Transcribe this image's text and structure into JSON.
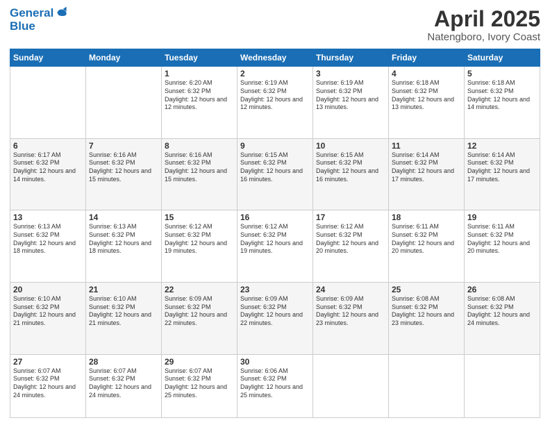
{
  "header": {
    "logo_line1": "General",
    "logo_line2": "Blue",
    "title": "April 2025",
    "subtitle": "Natengboro, Ivory Coast"
  },
  "weekdays": [
    "Sunday",
    "Monday",
    "Tuesday",
    "Wednesday",
    "Thursday",
    "Friday",
    "Saturday"
  ],
  "weeks": [
    [
      {
        "day": "",
        "sunrise": "",
        "sunset": "",
        "daylight": ""
      },
      {
        "day": "",
        "sunrise": "",
        "sunset": "",
        "daylight": ""
      },
      {
        "day": "1",
        "sunrise": "Sunrise: 6:20 AM",
        "sunset": "Sunset: 6:32 PM",
        "daylight": "Daylight: 12 hours and 12 minutes."
      },
      {
        "day": "2",
        "sunrise": "Sunrise: 6:19 AM",
        "sunset": "Sunset: 6:32 PM",
        "daylight": "Daylight: 12 hours and 12 minutes."
      },
      {
        "day": "3",
        "sunrise": "Sunrise: 6:19 AM",
        "sunset": "Sunset: 6:32 PM",
        "daylight": "Daylight: 12 hours and 13 minutes."
      },
      {
        "day": "4",
        "sunrise": "Sunrise: 6:18 AM",
        "sunset": "Sunset: 6:32 PM",
        "daylight": "Daylight: 12 hours and 13 minutes."
      },
      {
        "day": "5",
        "sunrise": "Sunrise: 6:18 AM",
        "sunset": "Sunset: 6:32 PM",
        "daylight": "Daylight: 12 hours and 14 minutes."
      }
    ],
    [
      {
        "day": "6",
        "sunrise": "Sunrise: 6:17 AM",
        "sunset": "Sunset: 6:32 PM",
        "daylight": "Daylight: 12 hours and 14 minutes."
      },
      {
        "day": "7",
        "sunrise": "Sunrise: 6:16 AM",
        "sunset": "Sunset: 6:32 PM",
        "daylight": "Daylight: 12 hours and 15 minutes."
      },
      {
        "day": "8",
        "sunrise": "Sunrise: 6:16 AM",
        "sunset": "Sunset: 6:32 PM",
        "daylight": "Daylight: 12 hours and 15 minutes."
      },
      {
        "day": "9",
        "sunrise": "Sunrise: 6:15 AM",
        "sunset": "Sunset: 6:32 PM",
        "daylight": "Daylight: 12 hours and 16 minutes."
      },
      {
        "day": "10",
        "sunrise": "Sunrise: 6:15 AM",
        "sunset": "Sunset: 6:32 PM",
        "daylight": "Daylight: 12 hours and 16 minutes."
      },
      {
        "day": "11",
        "sunrise": "Sunrise: 6:14 AM",
        "sunset": "Sunset: 6:32 PM",
        "daylight": "Daylight: 12 hours and 17 minutes."
      },
      {
        "day": "12",
        "sunrise": "Sunrise: 6:14 AM",
        "sunset": "Sunset: 6:32 PM",
        "daylight": "Daylight: 12 hours and 17 minutes."
      }
    ],
    [
      {
        "day": "13",
        "sunrise": "Sunrise: 6:13 AM",
        "sunset": "Sunset: 6:32 PM",
        "daylight": "Daylight: 12 hours and 18 minutes."
      },
      {
        "day": "14",
        "sunrise": "Sunrise: 6:13 AM",
        "sunset": "Sunset: 6:32 PM",
        "daylight": "Daylight: 12 hours and 18 minutes."
      },
      {
        "day": "15",
        "sunrise": "Sunrise: 6:12 AM",
        "sunset": "Sunset: 6:32 PM",
        "daylight": "Daylight: 12 hours and 19 minutes."
      },
      {
        "day": "16",
        "sunrise": "Sunrise: 6:12 AM",
        "sunset": "Sunset: 6:32 PM",
        "daylight": "Daylight: 12 hours and 19 minutes."
      },
      {
        "day": "17",
        "sunrise": "Sunrise: 6:12 AM",
        "sunset": "Sunset: 6:32 PM",
        "daylight": "Daylight: 12 hours and 20 minutes."
      },
      {
        "day": "18",
        "sunrise": "Sunrise: 6:11 AM",
        "sunset": "Sunset: 6:32 PM",
        "daylight": "Daylight: 12 hours and 20 minutes."
      },
      {
        "day": "19",
        "sunrise": "Sunrise: 6:11 AM",
        "sunset": "Sunset: 6:32 PM",
        "daylight": "Daylight: 12 hours and 20 minutes."
      }
    ],
    [
      {
        "day": "20",
        "sunrise": "Sunrise: 6:10 AM",
        "sunset": "Sunset: 6:32 PM",
        "daylight": "Daylight: 12 hours and 21 minutes."
      },
      {
        "day": "21",
        "sunrise": "Sunrise: 6:10 AM",
        "sunset": "Sunset: 6:32 PM",
        "daylight": "Daylight: 12 hours and 21 minutes."
      },
      {
        "day": "22",
        "sunrise": "Sunrise: 6:09 AM",
        "sunset": "Sunset: 6:32 PM",
        "daylight": "Daylight: 12 hours and 22 minutes."
      },
      {
        "day": "23",
        "sunrise": "Sunrise: 6:09 AM",
        "sunset": "Sunset: 6:32 PM",
        "daylight": "Daylight: 12 hours and 22 minutes."
      },
      {
        "day": "24",
        "sunrise": "Sunrise: 6:09 AM",
        "sunset": "Sunset: 6:32 PM",
        "daylight": "Daylight: 12 hours and 23 minutes."
      },
      {
        "day": "25",
        "sunrise": "Sunrise: 6:08 AM",
        "sunset": "Sunset: 6:32 PM",
        "daylight": "Daylight: 12 hours and 23 minutes."
      },
      {
        "day": "26",
        "sunrise": "Sunrise: 6:08 AM",
        "sunset": "Sunset: 6:32 PM",
        "daylight": "Daylight: 12 hours and 24 minutes."
      }
    ],
    [
      {
        "day": "27",
        "sunrise": "Sunrise: 6:07 AM",
        "sunset": "Sunset: 6:32 PM",
        "daylight": "Daylight: 12 hours and 24 minutes."
      },
      {
        "day": "28",
        "sunrise": "Sunrise: 6:07 AM",
        "sunset": "Sunset: 6:32 PM",
        "daylight": "Daylight: 12 hours and 24 minutes."
      },
      {
        "day": "29",
        "sunrise": "Sunrise: 6:07 AM",
        "sunset": "Sunset: 6:32 PM",
        "daylight": "Daylight: 12 hours and 25 minutes."
      },
      {
        "day": "30",
        "sunrise": "Sunrise: 6:06 AM",
        "sunset": "Sunset: 6:32 PM",
        "daylight": "Daylight: 12 hours and 25 minutes."
      },
      {
        "day": "",
        "sunrise": "",
        "sunset": "",
        "daylight": ""
      },
      {
        "day": "",
        "sunrise": "",
        "sunset": "",
        "daylight": ""
      },
      {
        "day": "",
        "sunrise": "",
        "sunset": "",
        "daylight": ""
      }
    ]
  ]
}
